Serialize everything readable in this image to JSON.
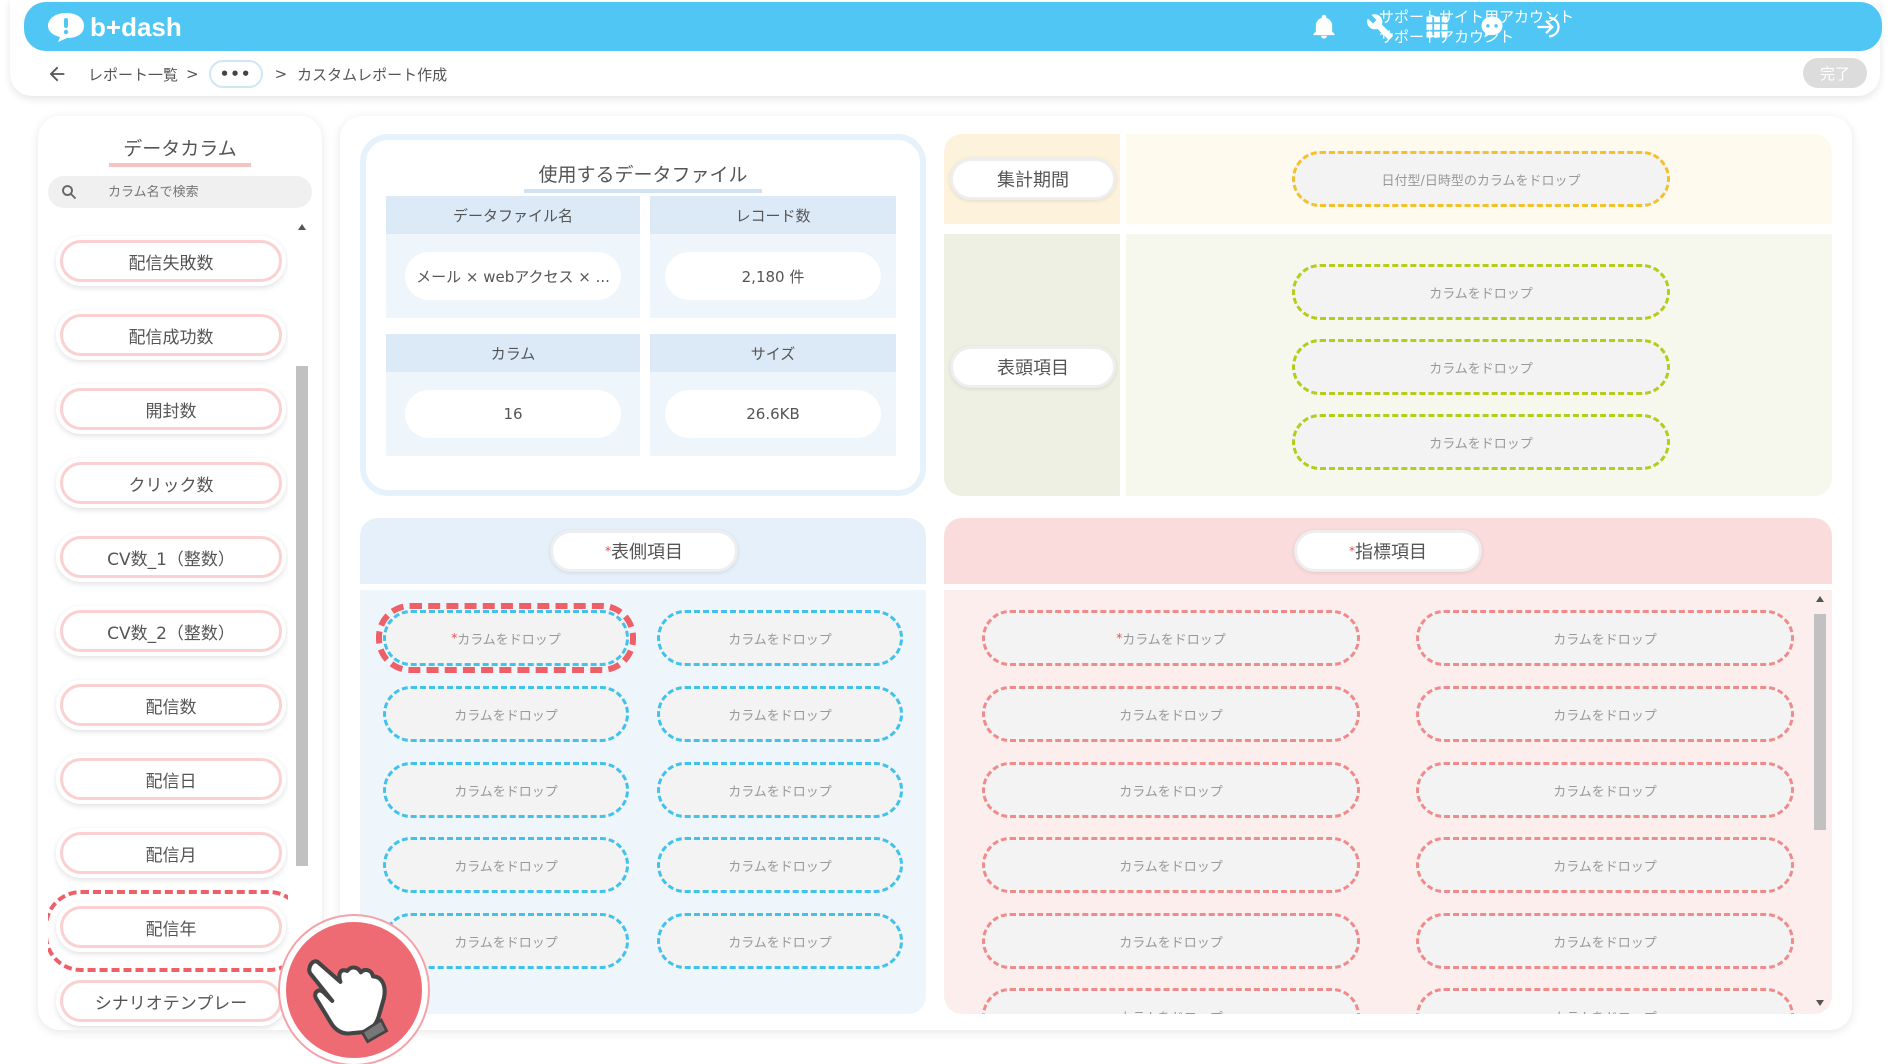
{
  "header": {
    "logo_text": "b+dash",
    "account_line1": "サポートサイト用アカウント",
    "account_line2": "サポートアカウント",
    "icons": [
      "bell-icon",
      "wrench-icon",
      "grid-icon",
      "support-bot-icon",
      "logout-icon"
    ],
    "brand_color": "#4fc6f4"
  },
  "breadcrumb": {
    "back": "back-arrow-icon",
    "item1": "レポート一覧",
    "sep": ">",
    "ellipsis": "•••",
    "current": "カスタムレポート作成"
  },
  "done_button": "完了",
  "left_panel": {
    "title": "データカラム",
    "search_placeholder": "カラム名で検索",
    "items": [
      "配信失敗数",
      "配信成功数",
      "開封数",
      "クリック数",
      "CV数_1（整数）",
      "CV数_2（整数）",
      "配信数",
      "配信日",
      "配信月",
      "配信年",
      "シナリオテンプレー"
    ],
    "selected_item": "配信年"
  },
  "data_file": {
    "title": "使用するデータファイル",
    "headers": [
      "データファイル名",
      "レコード数",
      "カラム",
      "サイズ"
    ],
    "values": [
      "メール × webアクセス × ...",
      "2,180 件",
      "16",
      "26.6KB"
    ]
  },
  "period": {
    "label": "集計期間",
    "drop": "日付型/日時型のカラムをドロップ"
  },
  "header_items": {
    "label": "表頭項目",
    "drops": [
      "カラムをドロップ",
      "カラムをドロップ",
      "カラムをドロップ"
    ]
  },
  "side_items": {
    "label": "表側項目",
    "required_mark": "*",
    "drop": "カラムをドロップ"
  },
  "metric_items": {
    "label": "指標項目",
    "required_mark": "*",
    "drop": "カラムをドロップ"
  },
  "colors": {
    "period_bg": "#fdf3dc",
    "period_drop_bg": "#fefbee",
    "header_bg": "#eef0e4",
    "header_drop_bg": "#f6f7ed",
    "side_bg": "#e6f0fa",
    "metric_bg": "#fbdcdc",
    "metric_drop_bg": "#fdeeee",
    "highlight": "#ee5f67"
  }
}
